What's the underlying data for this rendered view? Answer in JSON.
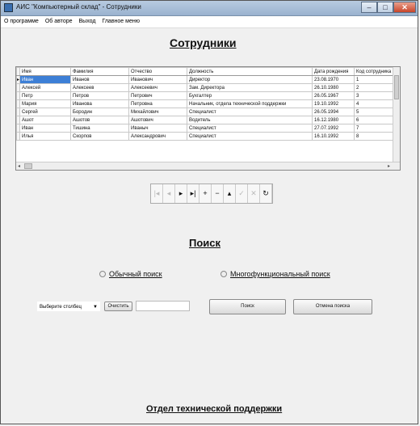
{
  "window": {
    "title": "АИС \"Компьютерный склад\" - Сотрудники",
    "buttons": {
      "minimize": "–",
      "maximize": "□",
      "close": "✕"
    }
  },
  "menu": [
    "О программе",
    "Об авторе",
    "Выход",
    "Главное меню"
  ],
  "page_title": "Сотрудники",
  "table": {
    "columns": [
      "Имя",
      "Фамилия",
      "Отчество",
      "Должность",
      "Дата рождения",
      "Код сотрудника"
    ],
    "rows": [
      [
        "Иван",
        "Иванов",
        "Иванович",
        "Директор",
        "23.08.1970",
        "1"
      ],
      [
        "Алексей",
        "Алексеев",
        "Алексеевич",
        "Зам. Директора",
        "26.10.1980",
        "2"
      ],
      [
        "Петр",
        "Петров",
        "Петрович",
        "Бухгалтер",
        "26.05.1967",
        "3"
      ],
      [
        "Мария",
        "Иванова",
        "Петровна",
        "Начальник, отдела технической поддержки",
        "19.10.1992",
        "4"
      ],
      [
        "Сергей",
        "Бородин",
        "Михайлович",
        "Специалист",
        "26.05.1994",
        "5"
      ],
      [
        "Ашот",
        "Ашотов",
        "Ашотович",
        "Водитель",
        "16.12.1980",
        "6"
      ],
      [
        "Иван",
        "Тишина",
        "Иваныч",
        "Специалист",
        "27.07.1992",
        "7"
      ],
      [
        "Илья",
        "Скорпов",
        "Александрович",
        "Специалист",
        "16.10.1992",
        "8"
      ]
    ],
    "selected_row": 0
  },
  "navigator": [
    {
      "name": "first-record",
      "glyph": "|◂",
      "enabled": false
    },
    {
      "name": "prev-record",
      "glyph": "◂",
      "enabled": false
    },
    {
      "name": "next-record",
      "glyph": "▸",
      "enabled": true
    },
    {
      "name": "last-record",
      "glyph": "▸|",
      "enabled": true
    },
    {
      "name": "insert-record",
      "glyph": "+",
      "enabled": true
    },
    {
      "name": "delete-record",
      "glyph": "−",
      "enabled": true
    },
    {
      "name": "edit-record",
      "glyph": "▴",
      "enabled": true
    },
    {
      "name": "post-record",
      "glyph": "✓",
      "enabled": false
    },
    {
      "name": "cancel-record",
      "glyph": "✕",
      "enabled": false
    },
    {
      "name": "refresh-record",
      "glyph": "↻",
      "enabled": true
    }
  ],
  "search": {
    "heading": "Поиск",
    "simple_label": "Обычный поиск",
    "multi_label": "Многофункциональный поиск",
    "column_select": "Выберите столбец",
    "clear_button": "Очистить",
    "search_button": "Поиск",
    "cancel_button": "Отмена поиска",
    "query_value": ""
  },
  "footer": "Отдел технической поддержки"
}
